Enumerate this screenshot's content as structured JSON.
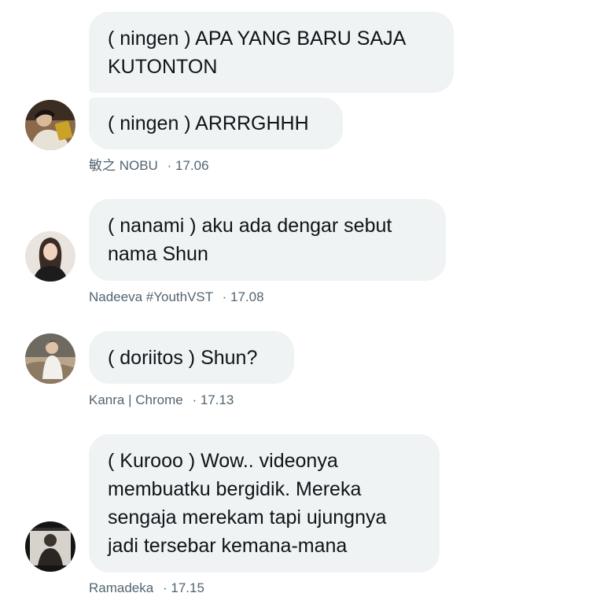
{
  "messages": [
    {
      "id": "nobu",
      "bubbles": [
        "( ningen ) APA YANG BARU SAJA KUTONTON",
        "( ningen ) ARRRGHHH"
      ],
      "sender": "敏之 NOBU",
      "time": "17.06"
    },
    {
      "id": "nadeeva",
      "bubbles": [
        "( nanami ) aku ada dengar sebut nama Shun"
      ],
      "sender": "Nadeeva #YouthVST",
      "time": "17.08"
    },
    {
      "id": "kanra",
      "bubbles": [
        "( doriitos ) Shun?"
      ],
      "sender": "Kanra | Chrome",
      "time": "17.13"
    },
    {
      "id": "ramadeka",
      "bubbles": [
        "( Kurooo ) Wow.. videonya membuatku bergidik. Mereka sengaja merekam tapi ujungnya jadi tersebar kemana-mana"
      ],
      "sender": "Ramadeka",
      "time": "17.15"
    }
  ],
  "separator": "·",
  "colors": {
    "bubble_bg": "#eff3f4",
    "meta_text": "#536471",
    "text": "#0f1419"
  }
}
